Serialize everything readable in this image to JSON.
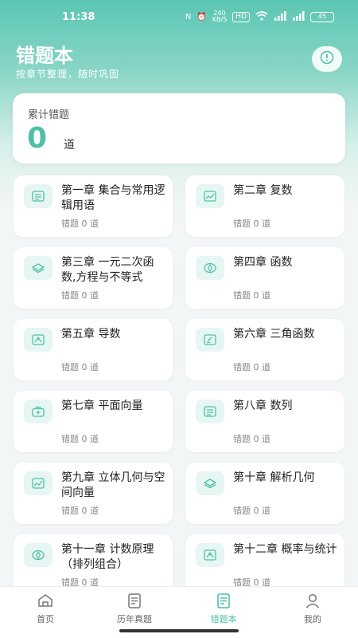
{
  "status_bar": {
    "time": "11:38",
    "net_speed": "240\nKB/S",
    "hd": "HD",
    "signal1": "5G",
    "signal2": "5G",
    "battery": "45"
  },
  "header": {
    "title": "错题本",
    "subtitle": "按章节整理，随时巩固",
    "info_icon": "info-icon"
  },
  "summary": {
    "label": "累计错题",
    "value": "0",
    "unit": "道"
  },
  "chapters": [
    {
      "title": "第一章 集合与常用逻辑用语",
      "count": "错题 0 道",
      "icon": "document-icon"
    },
    {
      "title": "第二章 复数",
      "count": "错题 0 道",
      "icon": "chart-icon"
    },
    {
      "title": "第三章 一元二次函数,方程与不等式",
      "count": "错题 0 道",
      "icon": "layers-icon"
    },
    {
      "title": "第四章 函数",
      "count": "错题 0 道",
      "icon": "eye-icon"
    },
    {
      "title": "第五章 导数",
      "count": "错题 0 道",
      "icon": "graph-icon"
    },
    {
      "title": "第六章 三角函数",
      "count": "错题 0 道",
      "icon": "edit-icon"
    },
    {
      "title": "第七章 平面向量",
      "count": "错题 0 道",
      "icon": "briefcase-icon"
    },
    {
      "title": "第八章 数列",
      "count": "错题 0 道",
      "icon": "document-icon"
    },
    {
      "title": "第九章 立体几何与空间向量",
      "count": "错题 0 道",
      "icon": "chart-icon"
    },
    {
      "title": "第十章 解析几何",
      "count": "错题 0 道",
      "icon": "layers-icon"
    },
    {
      "title": "第十一章 计数原理（排列组合）",
      "count": "错题 0 道",
      "icon": "eye-icon"
    },
    {
      "title": "第十二章 概率与统计",
      "count": "错题 0 道",
      "icon": "graph-icon"
    }
  ],
  "tabs": [
    {
      "label": "首页",
      "icon": "home-icon"
    },
    {
      "label": "历年真题",
      "icon": "paper-icon"
    },
    {
      "label": "错题本",
      "icon": "notebook-icon",
      "active": true
    },
    {
      "label": "我的",
      "icon": "user-icon"
    }
  ],
  "colors": {
    "accent": "#4fbfa7",
    "icon_bg": "#e6f6f2"
  }
}
